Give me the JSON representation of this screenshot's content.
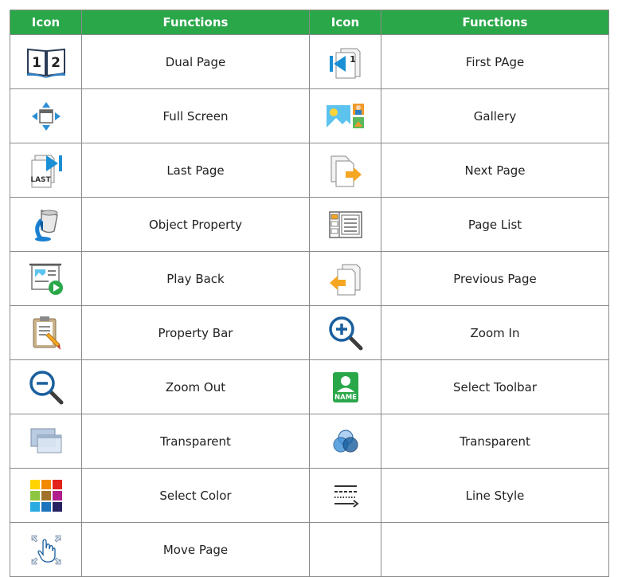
{
  "headers": [
    "Icon",
    "Functions",
    "Icon",
    "Functions"
  ],
  "rows": [
    {
      "left_icon": "dual-page-book-icon",
      "left": "Dual Page",
      "right_icon": "first-page-icon",
      "right": "First PAge"
    },
    {
      "left_icon": "full-screen-arrows-icon",
      "left": "Full Screen",
      "right_icon": "gallery-icon",
      "right": "Gallery"
    },
    {
      "left_icon": "last-page-icon",
      "left": "Last Page",
      "right_icon": "next-page-icon",
      "right": "Next Page"
    },
    {
      "left_icon": "paint-bucket-icon",
      "left": "Object Property",
      "right_icon": "page-list-icon",
      "right": "Page List"
    },
    {
      "left_icon": "play-back-icon",
      "left": "Play Back",
      "right_icon": "previous-page-icon",
      "right": "Previous Page"
    },
    {
      "left_icon": "clipboard-pencil-icon",
      "left": "Property Bar",
      "right_icon": "zoom-in-icon",
      "right": "Zoom In"
    },
    {
      "left_icon": "zoom-out-icon",
      "left": "Zoom Out",
      "right_icon": "name-badge-icon",
      "right": "Select Toolbar"
    },
    {
      "left_icon": "transparent-screens-icon",
      "left": "Transparent",
      "right_icon": "transparent-circles-icon",
      "right": "Transparent"
    },
    {
      "left_icon": "color-palette-icon",
      "left": "Select Color",
      "right_icon": "line-style-icon",
      "right": "Line Style"
    },
    {
      "left_icon": "move-page-hand-icon",
      "left": "Move Page",
      "right_icon": "",
      "right": ""
    }
  ],
  "icon_labels": {
    "page_one": "1",
    "page_two": "2",
    "last": "LAST",
    "name": "NAME"
  },
  "colors": {
    "header_green": "#2aa749",
    "icon_blue": "#1a8fd6",
    "border": "#8a8a8a"
  }
}
